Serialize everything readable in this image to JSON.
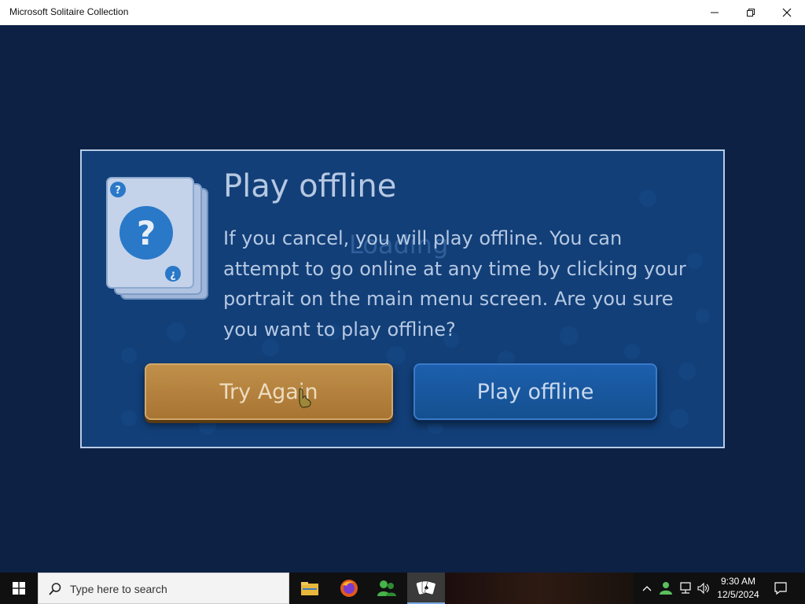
{
  "window": {
    "title": "Microsoft Solitaire Collection",
    "controls": {
      "minimize": "minimize-icon",
      "maximize": "restore-icon",
      "close": "close-icon"
    }
  },
  "dialog": {
    "title": "Play offline",
    "message": "If you cancel, you will play offline. You can attempt to go online at any time by clicking your portrait on the main menu screen. Are you sure you want to play offline?",
    "background_text": "Loading",
    "buttons": {
      "try_again": "Try Again",
      "play_offline": "Play offline"
    },
    "icon": "help-cards-icon"
  },
  "taskbar": {
    "search_placeholder": "Type here to search",
    "apps": [
      "file-explorer-icon",
      "firefox-icon",
      "people-app-icon",
      "solitaire-icon"
    ],
    "clock": {
      "time": "9:30 AM",
      "date": "12/5/2024"
    }
  },
  "colors": {
    "background": "#0c2143",
    "dialog": "#123f78",
    "try_again_button": "#b47c3a",
    "play_offline_button": "#1a58a4",
    "text": "#b6c8e2"
  }
}
